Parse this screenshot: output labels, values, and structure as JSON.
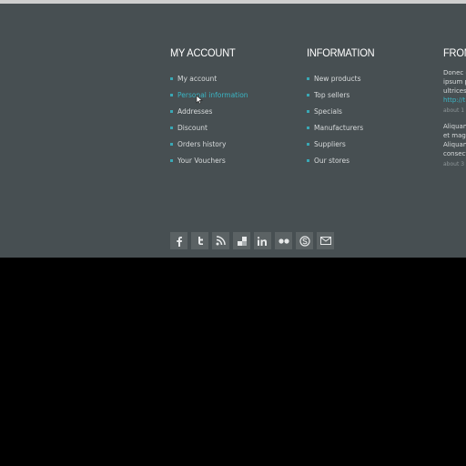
{
  "account": {
    "title": "MY ACCOUNT",
    "items": [
      {
        "label": "My account"
      },
      {
        "label": "Personal information"
      },
      {
        "label": "Addresses"
      },
      {
        "label": "Discount"
      },
      {
        "label": "Orders history"
      },
      {
        "label": "Your Vouchers"
      }
    ]
  },
  "information": {
    "title": "INFORMATION",
    "items": [
      {
        "label": "New products"
      },
      {
        "label": "Top sellers"
      },
      {
        "label": "Specials"
      },
      {
        "label": "Manufacturers"
      },
      {
        "label": "Suppliers"
      },
      {
        "label": "Our stores"
      }
    ]
  },
  "from": {
    "title": "FROM",
    "tweet1": {
      "line1": "Donec e",
      "line2": "ipsum p",
      "line3": "ultrices",
      "link": "http://t",
      "time": "about 1 h"
    },
    "tweet2": {
      "line1": "Aliquam",
      "line2": "et magn",
      "line3": "Aliquam",
      "line4": "consect",
      "time": "about 3 h"
    }
  },
  "social": [
    {
      "icon": "facebook-icon",
      "glyph": "f"
    },
    {
      "icon": "twitter-icon",
      "glyph": "t"
    },
    {
      "icon": "rss-icon",
      "glyph": "rss"
    },
    {
      "icon": "delicious-icon",
      "glyph": "del"
    },
    {
      "icon": "linkedin-icon",
      "glyph": "in"
    },
    {
      "icon": "flickr-icon",
      "glyph": "••"
    },
    {
      "icon": "skype-icon",
      "glyph": "S"
    },
    {
      "icon": "email-icon",
      "glyph": "✉"
    }
  ],
  "colors": {
    "footer_bg": "#474f52",
    "accent": "#3ab5c4",
    "page_bg": "#000000"
  }
}
